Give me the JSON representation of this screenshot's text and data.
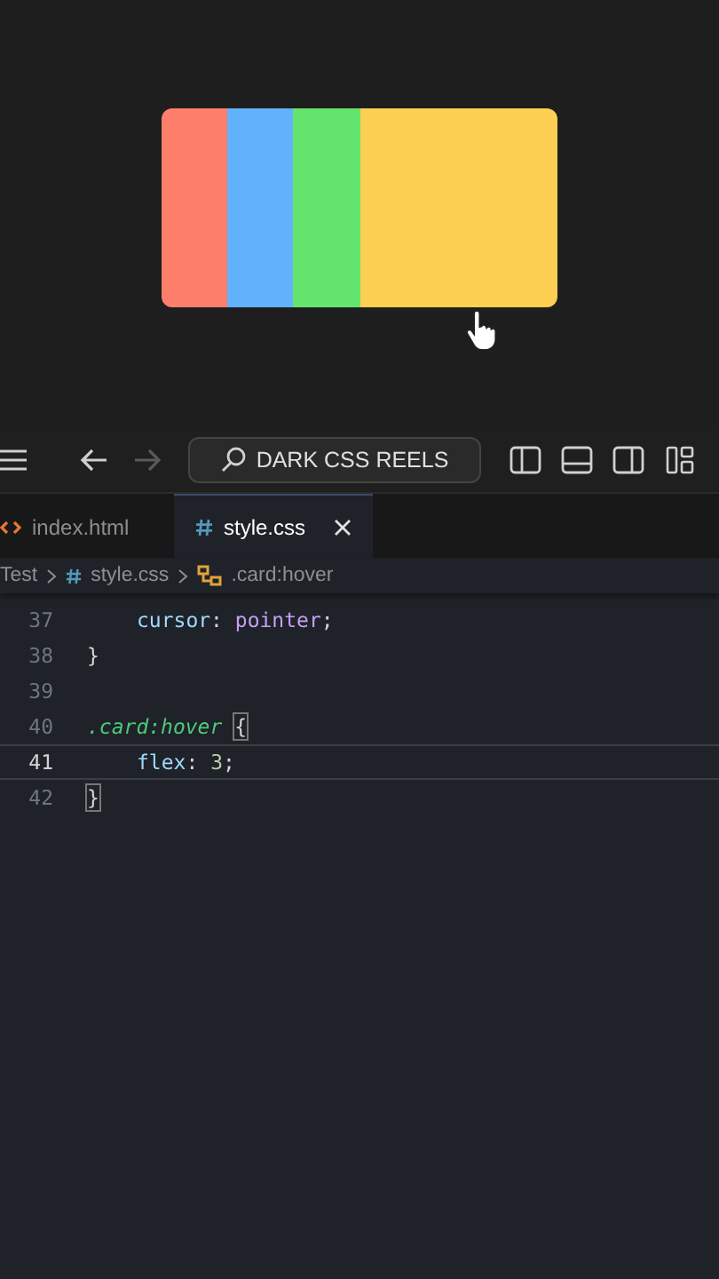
{
  "preview": {
    "cards": [
      {
        "color": "#fe7f6b",
        "hovered": false
      },
      {
        "color": "#62b2fe",
        "hovered": false
      },
      {
        "color": "#64e46f",
        "hovered": false
      },
      {
        "color": "#fdcf52",
        "hovered": true
      }
    ]
  },
  "toolbar": {
    "back_disabled": false,
    "forward_disabled": true,
    "search": "DARK CSS REELS"
  },
  "tabs": [
    {
      "label": "index.html",
      "kind": "html",
      "selected": false
    },
    {
      "label": "style.css",
      "kind": "css",
      "selected": true
    }
  ],
  "breadcrumb": [
    {
      "label": "Test",
      "kind": "folder"
    },
    {
      "label": "style.css",
      "kind": "css"
    },
    {
      "label": ".card:hover",
      "kind": "selector"
    }
  ],
  "editor": {
    "lines": [
      {
        "number": "37",
        "current": false,
        "indented": true,
        "tokens": [
          {
            "text": "cursor",
            "kind": "property"
          },
          {
            "text": ": ",
            "kind": "punct"
          },
          {
            "text": "pointer",
            "kind": "value"
          },
          {
            "text": ";",
            "kind": "punct"
          }
        ]
      },
      {
        "number": "38",
        "current": false,
        "indented": false,
        "tokens": [
          {
            "text": "}",
            "kind": "punct"
          }
        ]
      },
      {
        "number": "39",
        "current": false
      },
      {
        "number": "40",
        "current": false,
        "indented": false,
        "tokens": [
          {
            "text": ".card:hover",
            "kind": "selector"
          },
          {
            "text": "{",
            "kind": "bracket"
          }
        ]
      },
      {
        "number": "41",
        "current": true,
        "indented": true,
        "tokens": [
          {
            "text": "flex",
            "kind": "property"
          },
          {
            "text": ": ",
            "kind": "punct"
          },
          {
            "text": "3",
            "kind": "number"
          },
          {
            "text": ";",
            "kind": "punct"
          }
        ]
      },
      {
        "number": "42",
        "current": false,
        "indented": false,
        "tokens": [
          {
            "text": "}",
            "kind": "bracket"
          }
        ]
      }
    ]
  }
}
